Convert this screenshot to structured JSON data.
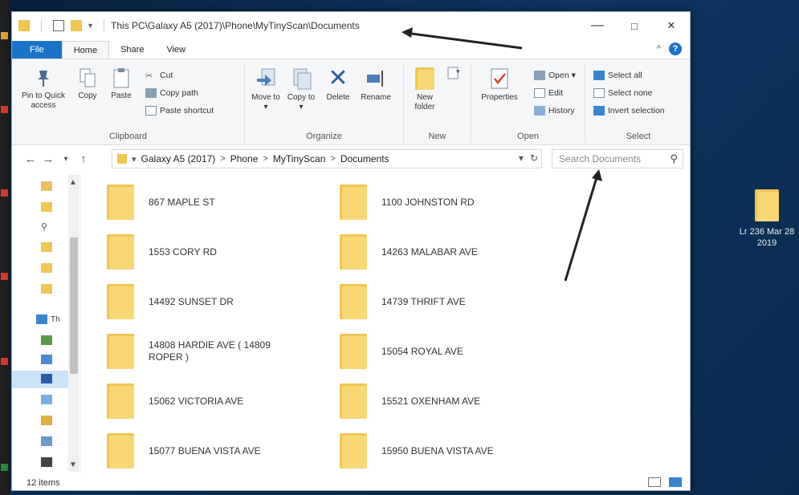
{
  "window": {
    "title": "This PC\\Galaxy A5 (2017)\\Phone\\MyTinyScan\\Documents",
    "minimize": "—",
    "maximize": "□",
    "close": "✕"
  },
  "tabs": [
    {
      "label": "File"
    },
    {
      "label": "Home"
    },
    {
      "label": "Share"
    },
    {
      "label": "View"
    }
  ],
  "ribbon": {
    "clipboard": {
      "pin_label": "Pin to Quick access",
      "copy_label": "Copy",
      "paste_label": "Paste",
      "cut_label": "Cut",
      "copy_path_label": "Copy path",
      "paste_shortcut_label": "Paste shortcut",
      "group_label": "Clipboard"
    },
    "organize": {
      "move_label": "Move to ▾",
      "copy_to_label": "Copy to ▾",
      "delete_label": "Delete",
      "rename_label": "Rename",
      "group_label": "Organize"
    },
    "new": {
      "new_folder_label": "New folder",
      "group_label": "New"
    },
    "open": {
      "properties_label": "Properties",
      "open_label": "Open ▾",
      "edit_label": "Edit",
      "history_label": "History",
      "group_label": "Open"
    },
    "select": {
      "select_all_label": "Select all",
      "select_none_label": "Select none",
      "invert_label": "Invert selection",
      "group_label": "Select"
    }
  },
  "address": {
    "crumbs": [
      "Galaxy A5 (2017)",
      "Phone",
      "MyTinyScan",
      "Documents"
    ],
    "search_placeholder": "Search Documents"
  },
  "files": [
    {
      "name": "867 MAPLE ST"
    },
    {
      "name": "1100 JOHNSTON RD"
    },
    {
      "name": "1553 CORY RD"
    },
    {
      "name": "14263 MALABAR AVE"
    },
    {
      "name": "14492 SUNSET DR"
    },
    {
      "name": "14739 THRIFT AVE"
    },
    {
      "name": "14808 HARDIE AVE ( 14809 ROPER )"
    },
    {
      "name": "15054 ROYAL AVE"
    },
    {
      "name": "15062 VICTORIA AVE"
    },
    {
      "name": "15521 OXENHAM AVE"
    },
    {
      "name": "15077 BUENA VISTA AVE"
    },
    {
      "name": "15950 BUENA VISTA AVE"
    }
  ],
  "navpane": {
    "this_pc_label": "Th"
  },
  "status": {
    "item_count": "12 items"
  },
  "desktop": {
    "icon_label": "Lr 236 Mar 28 2019"
  },
  "colors": {
    "accent": "#1a73c8",
    "folder": "#f8d775",
    "desktop_bg": "#0c3560"
  }
}
